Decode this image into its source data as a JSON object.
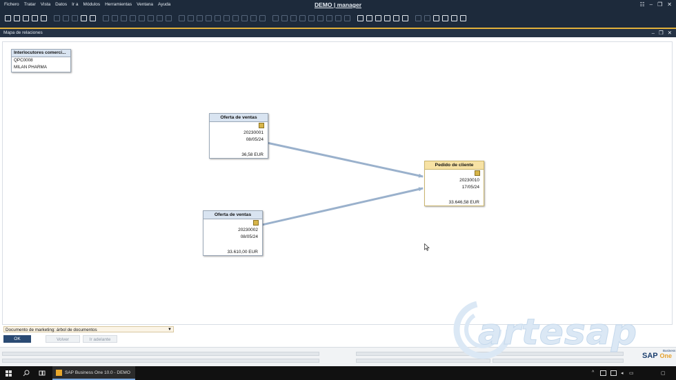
{
  "menubar": {
    "items": [
      "Fichero",
      "Tratar",
      "Vista",
      "Datos",
      "Ir a",
      "Módulos",
      "Herramientas",
      "Ventana",
      "Ayuda"
    ],
    "company": "DEMO",
    "separator": " | ",
    "user": "manager",
    "controls": [
      "☷",
      "–",
      "❐",
      "✕"
    ]
  },
  "window": {
    "title": "Mapa de relaciones",
    "controls": [
      "–",
      "❐",
      "✕"
    ]
  },
  "business_partner": {
    "header": "Interlocutores comerci...",
    "code": "QPC0008",
    "name": "MILAN PHARMA"
  },
  "documents": [
    {
      "title": "Oferta de ventas",
      "number": "20230001",
      "date": "08/05/24",
      "total": "36,58 EUR",
      "icon": "document-icon",
      "color": "#d9e4f1"
    },
    {
      "title": "Oferta de ventas",
      "number": "20230002",
      "date": "08/05/24",
      "total": "33.610,00 EUR",
      "icon": "document-icon",
      "color": "#d9e4f1"
    },
    {
      "title": "Pedido de cliente",
      "number": "20230010",
      "date": "17/05/24",
      "total": "33.646,58 EUR",
      "icon": "document-icon",
      "color": "#f7e2a4"
    }
  ],
  "footer": {
    "doc_tree": "Documento de marketing: árbol de documentos",
    "ok": "OK",
    "back": "Volver",
    "forward": "Ir adelante"
  },
  "watermark": "artesap",
  "brand": {
    "sap": "SAP",
    "business": "Business",
    "one": "One"
  },
  "taskbar": {
    "app": "SAP Business One 10.0 - DEMO"
  },
  "colors": {
    "chrome": "#1d2a3b",
    "accent": "#e2b23a",
    "connector": "#9ab1cc"
  }
}
